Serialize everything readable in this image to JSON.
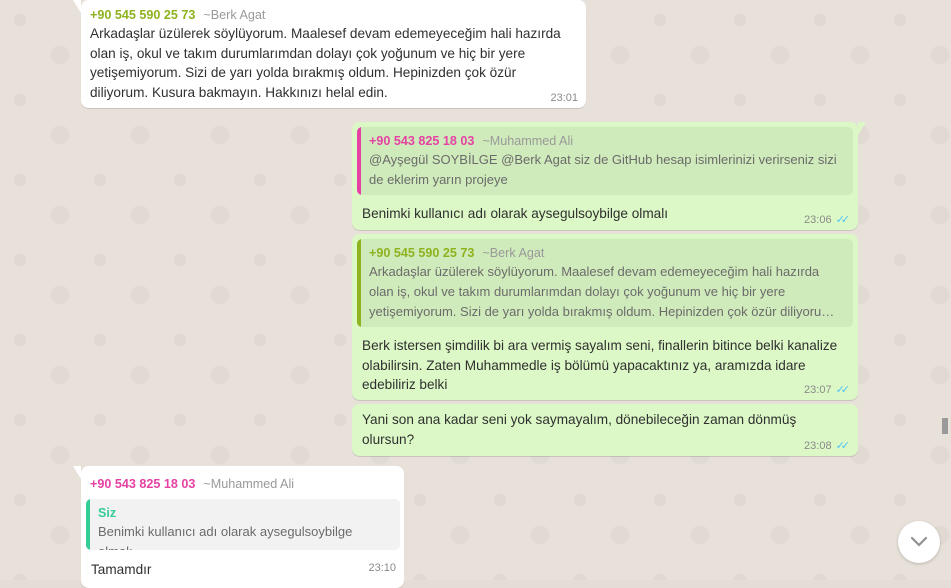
{
  "colors": {
    "green_sender": "#8fb21f",
    "pink_sender": "#e542a3",
    "you_label": "#35cd96",
    "ticks": "#4fc3f7"
  },
  "messages": [
    {
      "sender_phone": "+90 545 590 25 73",
      "sender_alias": "~Berk Agat",
      "text": "Arkadaşlar üzülerek söylüyorum. Maalesef devam edemeyeceğim hali hazırda olan iş, okul ve takım durumlarımdan dolayı çok yoğunum ve hiç bir yere yetişemiyorum. Sizi de yarı yolda bırakmış oldum. Hepinizden çok özür diliyorum. Kusura bakmayın. Hakkınızı helal edin.",
      "time": "23:01"
    },
    {
      "quote_phone": "+90 543 825 18 03",
      "quote_alias": "~Muhammed Ali",
      "quote_text": "@Ayşegül SOYBİLGE @Berk Agat siz de GitHub hesap isimlerinizi verirseniz sizi de eklerim yarın projeye",
      "text": "Benimki kullanıcı adı olarak aysegulsoybilge olmalı",
      "time": "23:06"
    },
    {
      "quote_phone": "+90 545 590 25 73",
      "quote_alias": "~Berk Agat",
      "quote_text": "Arkadaşlar üzülerek söylüyorum. Maalesef devam edemeyeceğim hali hazırda olan iş, okul ve takım durumlarımdan dolayı çok yoğunum ve hiç bir yere yetişemiyorum. Sizi de yarı yolda bırakmış oldum. Hepinizden çok özür diliyoru…",
      "text": "Berk istersen şimdilik bi ara vermiş sayalım seni, finallerin bitince belki kanalize olabilirsin. Zaten Muhammedle iş bölümü yapacaktınız ya, aramızda idare edebiliriz belki",
      "time": "23:07"
    },
    {
      "text": "Yani son ana kadar seni yok saymayalım, dönebileceğin zaman dönmüş olursun?",
      "time": "23:08"
    },
    {
      "sender_phone": "+90 543 825 18 03",
      "sender_alias": "~Muhammed Ali",
      "quote_sender": "Siz",
      "quote_text": "Benimki kullanıcı adı olarak aysegulsoybilge olmalı",
      "text": "Tamamdır",
      "time": "23:10"
    }
  ],
  "icons": {
    "ticks": "double-check-icon",
    "scroll": "chevron-down-icon"
  }
}
